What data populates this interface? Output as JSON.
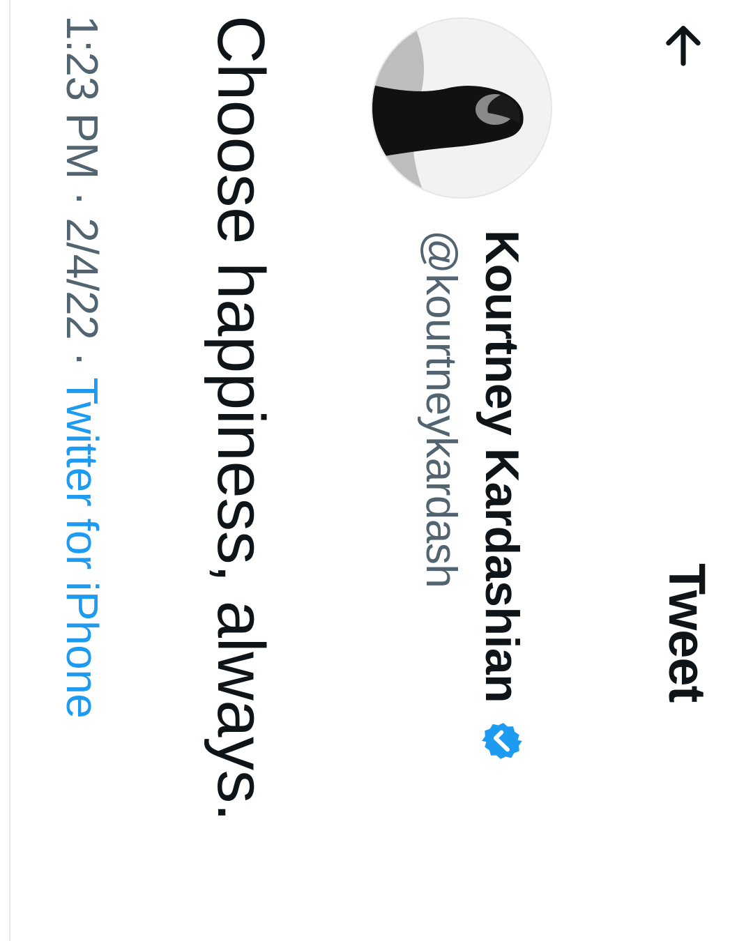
{
  "header": {
    "title": "Tweet",
    "back_icon": "arrow-left-icon"
  },
  "author": {
    "display_name": "Kourtney Kardashian",
    "handle": "@kourtneykardash",
    "verified_icon": "verified-badge-icon",
    "avatar_icon": "profile-photo"
  },
  "tweet": {
    "text": "Choose happiness, always.",
    "time": "1:23 PM",
    "date": "2/4/22",
    "separator": "·",
    "source": "Twitter for iPhone"
  },
  "colors": {
    "verified": "#1d9bf0",
    "link": "#1d9bf0",
    "secondary_text": "#536471",
    "primary_text": "#0f1419"
  }
}
